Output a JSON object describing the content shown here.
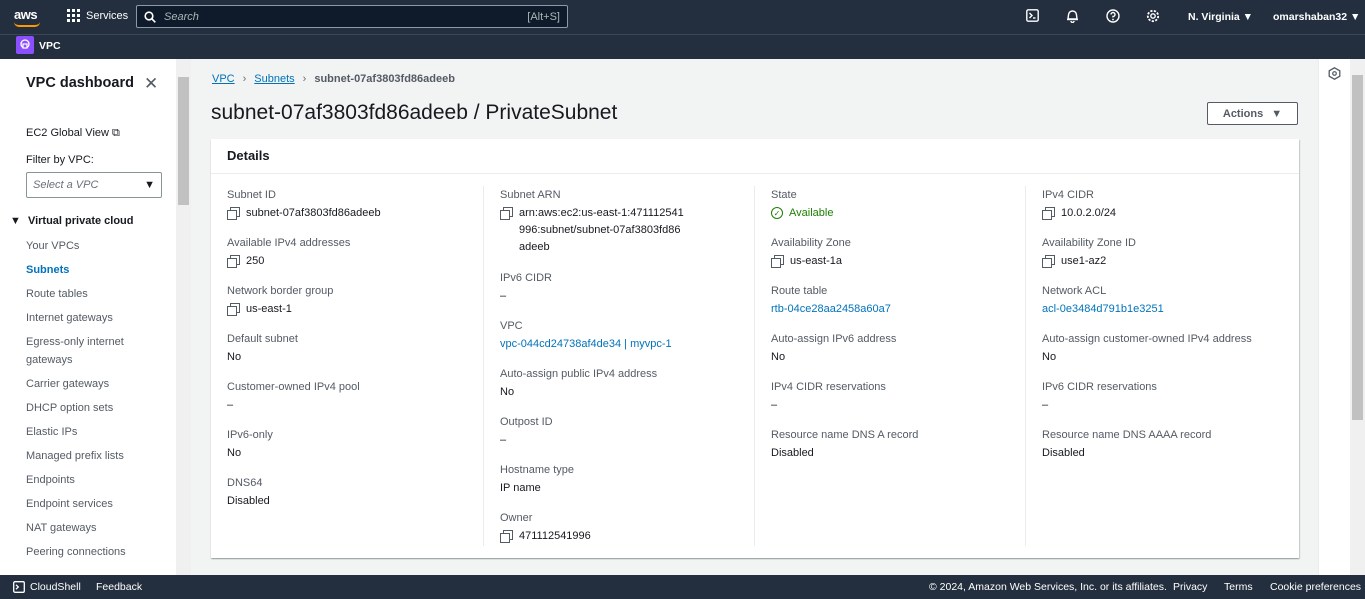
{
  "header": {
    "logo": "aws",
    "services": "Services",
    "search_placeholder": "Search",
    "search_shortcut": "[Alt+S]",
    "region": "N. Virginia",
    "user": "omarshaban32",
    "icons": [
      "cloudshell-icon",
      "bell-icon",
      "help-icon",
      "settings-icon"
    ]
  },
  "subheader": {
    "service": "VPC"
  },
  "sidebar": {
    "title": "VPC dashboard",
    "ec2_global": "EC2 Global View",
    "filter_label": "Filter by VPC:",
    "filter_placeholder": "Select a VPC",
    "section": "Virtual private cloud",
    "items": [
      {
        "label": "Your VPCs",
        "active": false
      },
      {
        "label": "Subnets",
        "active": true
      },
      {
        "label": "Route tables",
        "active": false
      },
      {
        "label": "Internet gateways",
        "active": false
      },
      {
        "label": "Egress-only internet gateways",
        "active": false
      },
      {
        "label": "Carrier gateways",
        "active": false
      },
      {
        "label": "DHCP option sets",
        "active": false
      },
      {
        "label": "Elastic IPs",
        "active": false
      },
      {
        "label": "Managed prefix lists",
        "active": false
      },
      {
        "label": "Endpoints",
        "active": false
      },
      {
        "label": "Endpoint services",
        "active": false
      },
      {
        "label": "NAT gateways",
        "active": false
      },
      {
        "label": "Peering connections",
        "active": false
      }
    ]
  },
  "breadcrumb": {
    "vpc": "VPC",
    "subnets": "Subnets",
    "current": "subnet-07af3803fd86adeeb"
  },
  "page_title": "subnet-07af3803fd86adeeb / PrivateSubnet",
  "actions_label": "Actions",
  "details": {
    "title": "Details",
    "columns": [
      [
        {
          "label": "Subnet ID",
          "value": "subnet-07af3803fd86adeeb",
          "copy": true
        },
        {
          "label": "Available IPv4 addresses",
          "value": "250",
          "copy": true
        },
        {
          "label": "Network border group",
          "value": "us-east-1",
          "copy": true
        },
        {
          "label": "Default subnet",
          "value": "No"
        },
        {
          "label": "Customer-owned IPv4 pool",
          "value": "–"
        },
        {
          "label": "IPv6-only",
          "value": "No"
        },
        {
          "label": "DNS64",
          "value": "Disabled"
        }
      ],
      [
        {
          "label": "Subnet ARN",
          "value": "arn:aws:ec2:us-east-1:471112541996:subnet/subnet-07af3803fd86adeeb",
          "copy": true
        },
        {
          "label": "IPv6 CIDR",
          "value": "–"
        },
        {
          "label": "VPC",
          "value": "vpc-044cd24738af4de34 | myvpc-1",
          "link": true
        },
        {
          "label": "Auto-assign public IPv4 address",
          "value": "No"
        },
        {
          "label": "Outpost ID",
          "value": "–"
        },
        {
          "label": "Hostname type",
          "value": "IP name"
        },
        {
          "label": "Owner",
          "value": "471112541996",
          "copy": true
        }
      ],
      [
        {
          "label": "State",
          "value": "Available",
          "status": "ok"
        },
        {
          "label": "Availability Zone",
          "value": "us-east-1a",
          "copy": true
        },
        {
          "label": "Route table",
          "value": "rtb-04ce28aa2458a60a7",
          "link": true
        },
        {
          "label": "Auto-assign IPv6 address",
          "value": "No"
        },
        {
          "label": "IPv4 CIDR reservations",
          "value": "–"
        },
        {
          "label": "Resource name DNS A record",
          "value": "Disabled"
        }
      ],
      [
        {
          "label": "IPv4 CIDR",
          "value": "10.0.2.0/24",
          "copy": true
        },
        {
          "label": "Availability Zone ID",
          "value": "use1-az2",
          "copy": true
        },
        {
          "label": "Network ACL",
          "value": "acl-0e3484d791b1e3251",
          "link": true
        },
        {
          "label": "Auto-assign customer-owned IPv4 address",
          "value": "No"
        },
        {
          "label": "IPv6 CIDR reservations",
          "value": "–"
        },
        {
          "label": "Resource name DNS AAAA record",
          "value": "Disabled"
        }
      ]
    ]
  },
  "footer": {
    "cloudshell": "CloudShell",
    "feedback": "Feedback",
    "copyright": "© 2024, Amazon Web Services, Inc. or its affiliates.",
    "privacy": "Privacy",
    "terms": "Terms",
    "cookies": "Cookie preferences"
  },
  "colors": {
    "nav": "#232f3e",
    "link": "#0073bb",
    "accent": "#ff9900",
    "success": "#1d8102"
  }
}
